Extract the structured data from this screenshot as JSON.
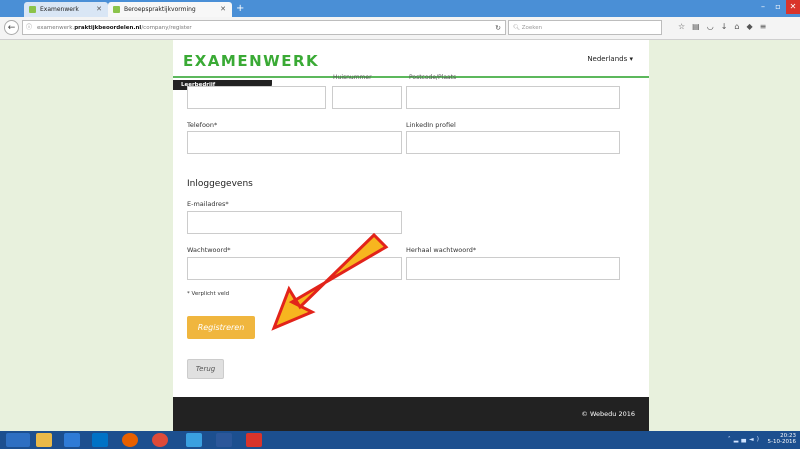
{
  "browser": {
    "tabs": [
      {
        "label": "Examenwerk"
      },
      {
        "label": "Beroepspraktijkvorming"
      }
    ],
    "new_tab": "+",
    "url_prefix": "examenwerk.",
    "url_domain": "praktijkbeoordelen.nl",
    "url_path": "/company/register",
    "search_placeholder": "Zoeken"
  },
  "header": {
    "logo": "EXAMENWERK",
    "language": "Nederlands",
    "banner": "Leerbedrijf"
  },
  "form": {
    "cut_label_1": "Huisnummer",
    "cut_label_2": "Postcode/Plaats",
    "phone_label": "Telefoon*",
    "linkedin_label": "LinkedIn profiel",
    "section_title": "Inloggegevens",
    "email_label": "E-mailadres*",
    "password_label": "Wachtwoord*",
    "repeat_password_label": "Herhaal wachtwoord*",
    "required_note": "* Verplicht veld",
    "register_button": "Registreren",
    "back_button": "Terug"
  },
  "footer": {
    "copyright": "© Webedu 2016"
  },
  "taskbar": {
    "time": "20:23",
    "date": "5-10-2016"
  },
  "colors": {
    "brand_green": "#3aaa35",
    "register_button": "#f0b63e",
    "arrow_fill": "#f7b51f",
    "arrow_outline": "#e2231a"
  }
}
